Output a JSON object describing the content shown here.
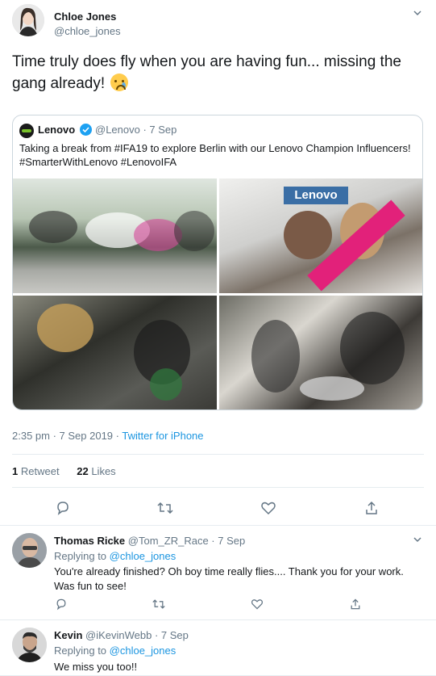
{
  "main_tweet": {
    "author_name": "Chloe Jones",
    "author_handle": "@chloe_jones",
    "text": "Time truly does fly when you are having fun... missing the gang already!",
    "emoji": "crying-face-icon",
    "quoted": {
      "author_name": "Lenovo",
      "author_handle_date": "@Lenovo · 7 Sep",
      "text": "Taking a break from #IFA19 to explore Berlin with our Lenovo Champion Influencers! #SmarterWithLenovo #LenovoIFA",
      "banner_text": "Lenovo",
      "images": [
        "group-photo-bikes",
        "lenovo-booth-photo",
        "influencers-table-photo",
        "workshop-photo"
      ]
    },
    "timestamp": "2:35 pm · 7 Sep 2019",
    "source_sep": " · ",
    "source": "Twitter for iPhone",
    "retweets_count": "1",
    "retweets_label": "Retweet",
    "likes_count": "22",
    "likes_label": "Likes"
  },
  "replies": [
    {
      "author_name": "Thomas Ricke",
      "handle_date": "@Tom_ZR_Race · 7 Sep",
      "replying_prefix": "Replying to ",
      "replying_to": "@chloe_jones",
      "text": "You're already finished? Oh boy time really flies.... Thank you for your work. Was fun to see!"
    },
    {
      "author_name": "Kevin",
      "handle_date": "@iKevinWebb · 7 Sep",
      "replying_prefix": "Replying to ",
      "replying_to": "@chloe_jones",
      "text": "We miss you too!!"
    }
  ],
  "colors": {
    "link": "#1b95e0",
    "secondary_text": "#657786",
    "border": "#e6ecf0",
    "verified": "#1da1f2"
  }
}
